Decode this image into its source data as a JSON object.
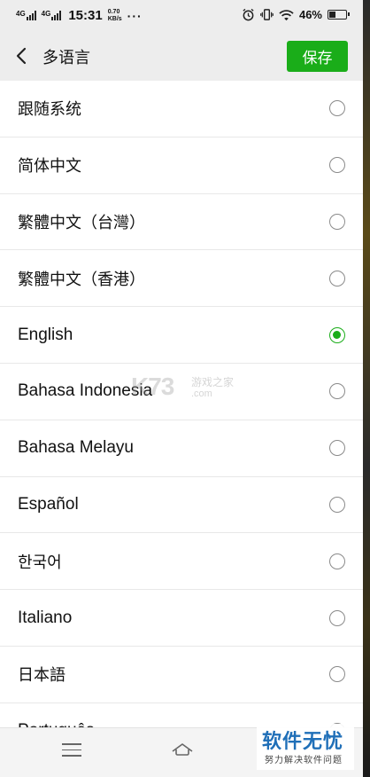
{
  "status_bar": {
    "network_1": "4G",
    "network_2": "4G",
    "time": "15:31",
    "speed_value": "0.70",
    "speed_unit": "KB/s",
    "more_dots": "···",
    "battery_percent": "46%",
    "battery_level": 0.46
  },
  "nav": {
    "title": "多语言",
    "save_label": "保存"
  },
  "languages": [
    {
      "label": "跟随系统",
      "selected": false
    },
    {
      "label": "简体中文",
      "selected": false
    },
    {
      "label": "繁體中文（台灣）",
      "selected": false
    },
    {
      "label": "繁體中文（香港）",
      "selected": false
    },
    {
      "label": "English",
      "selected": true
    },
    {
      "label": "Bahasa Indonesia",
      "selected": false
    },
    {
      "label": "Bahasa Melayu",
      "selected": false
    },
    {
      "label": "Español",
      "selected": false
    },
    {
      "label": "한국어",
      "selected": false
    },
    {
      "label": "Italiano",
      "selected": false
    },
    {
      "label": "日本語",
      "selected": false
    },
    {
      "label": "Português",
      "selected": false
    }
  ],
  "watermark": {
    "logo": "K73",
    "text_cn": "游戏之家",
    "domain": ".com"
  },
  "stamp": {
    "title": "软件无忧",
    "subtitle": "努力解决软件问题"
  },
  "colors": {
    "accent_green": "#1aad19",
    "header_bg": "#ededed"
  },
  "icons": [
    "back-arrow-icon",
    "alarm-icon",
    "vibrate-icon",
    "wifi-icon",
    "battery-icon",
    "menu-icon",
    "home-icon"
  ]
}
